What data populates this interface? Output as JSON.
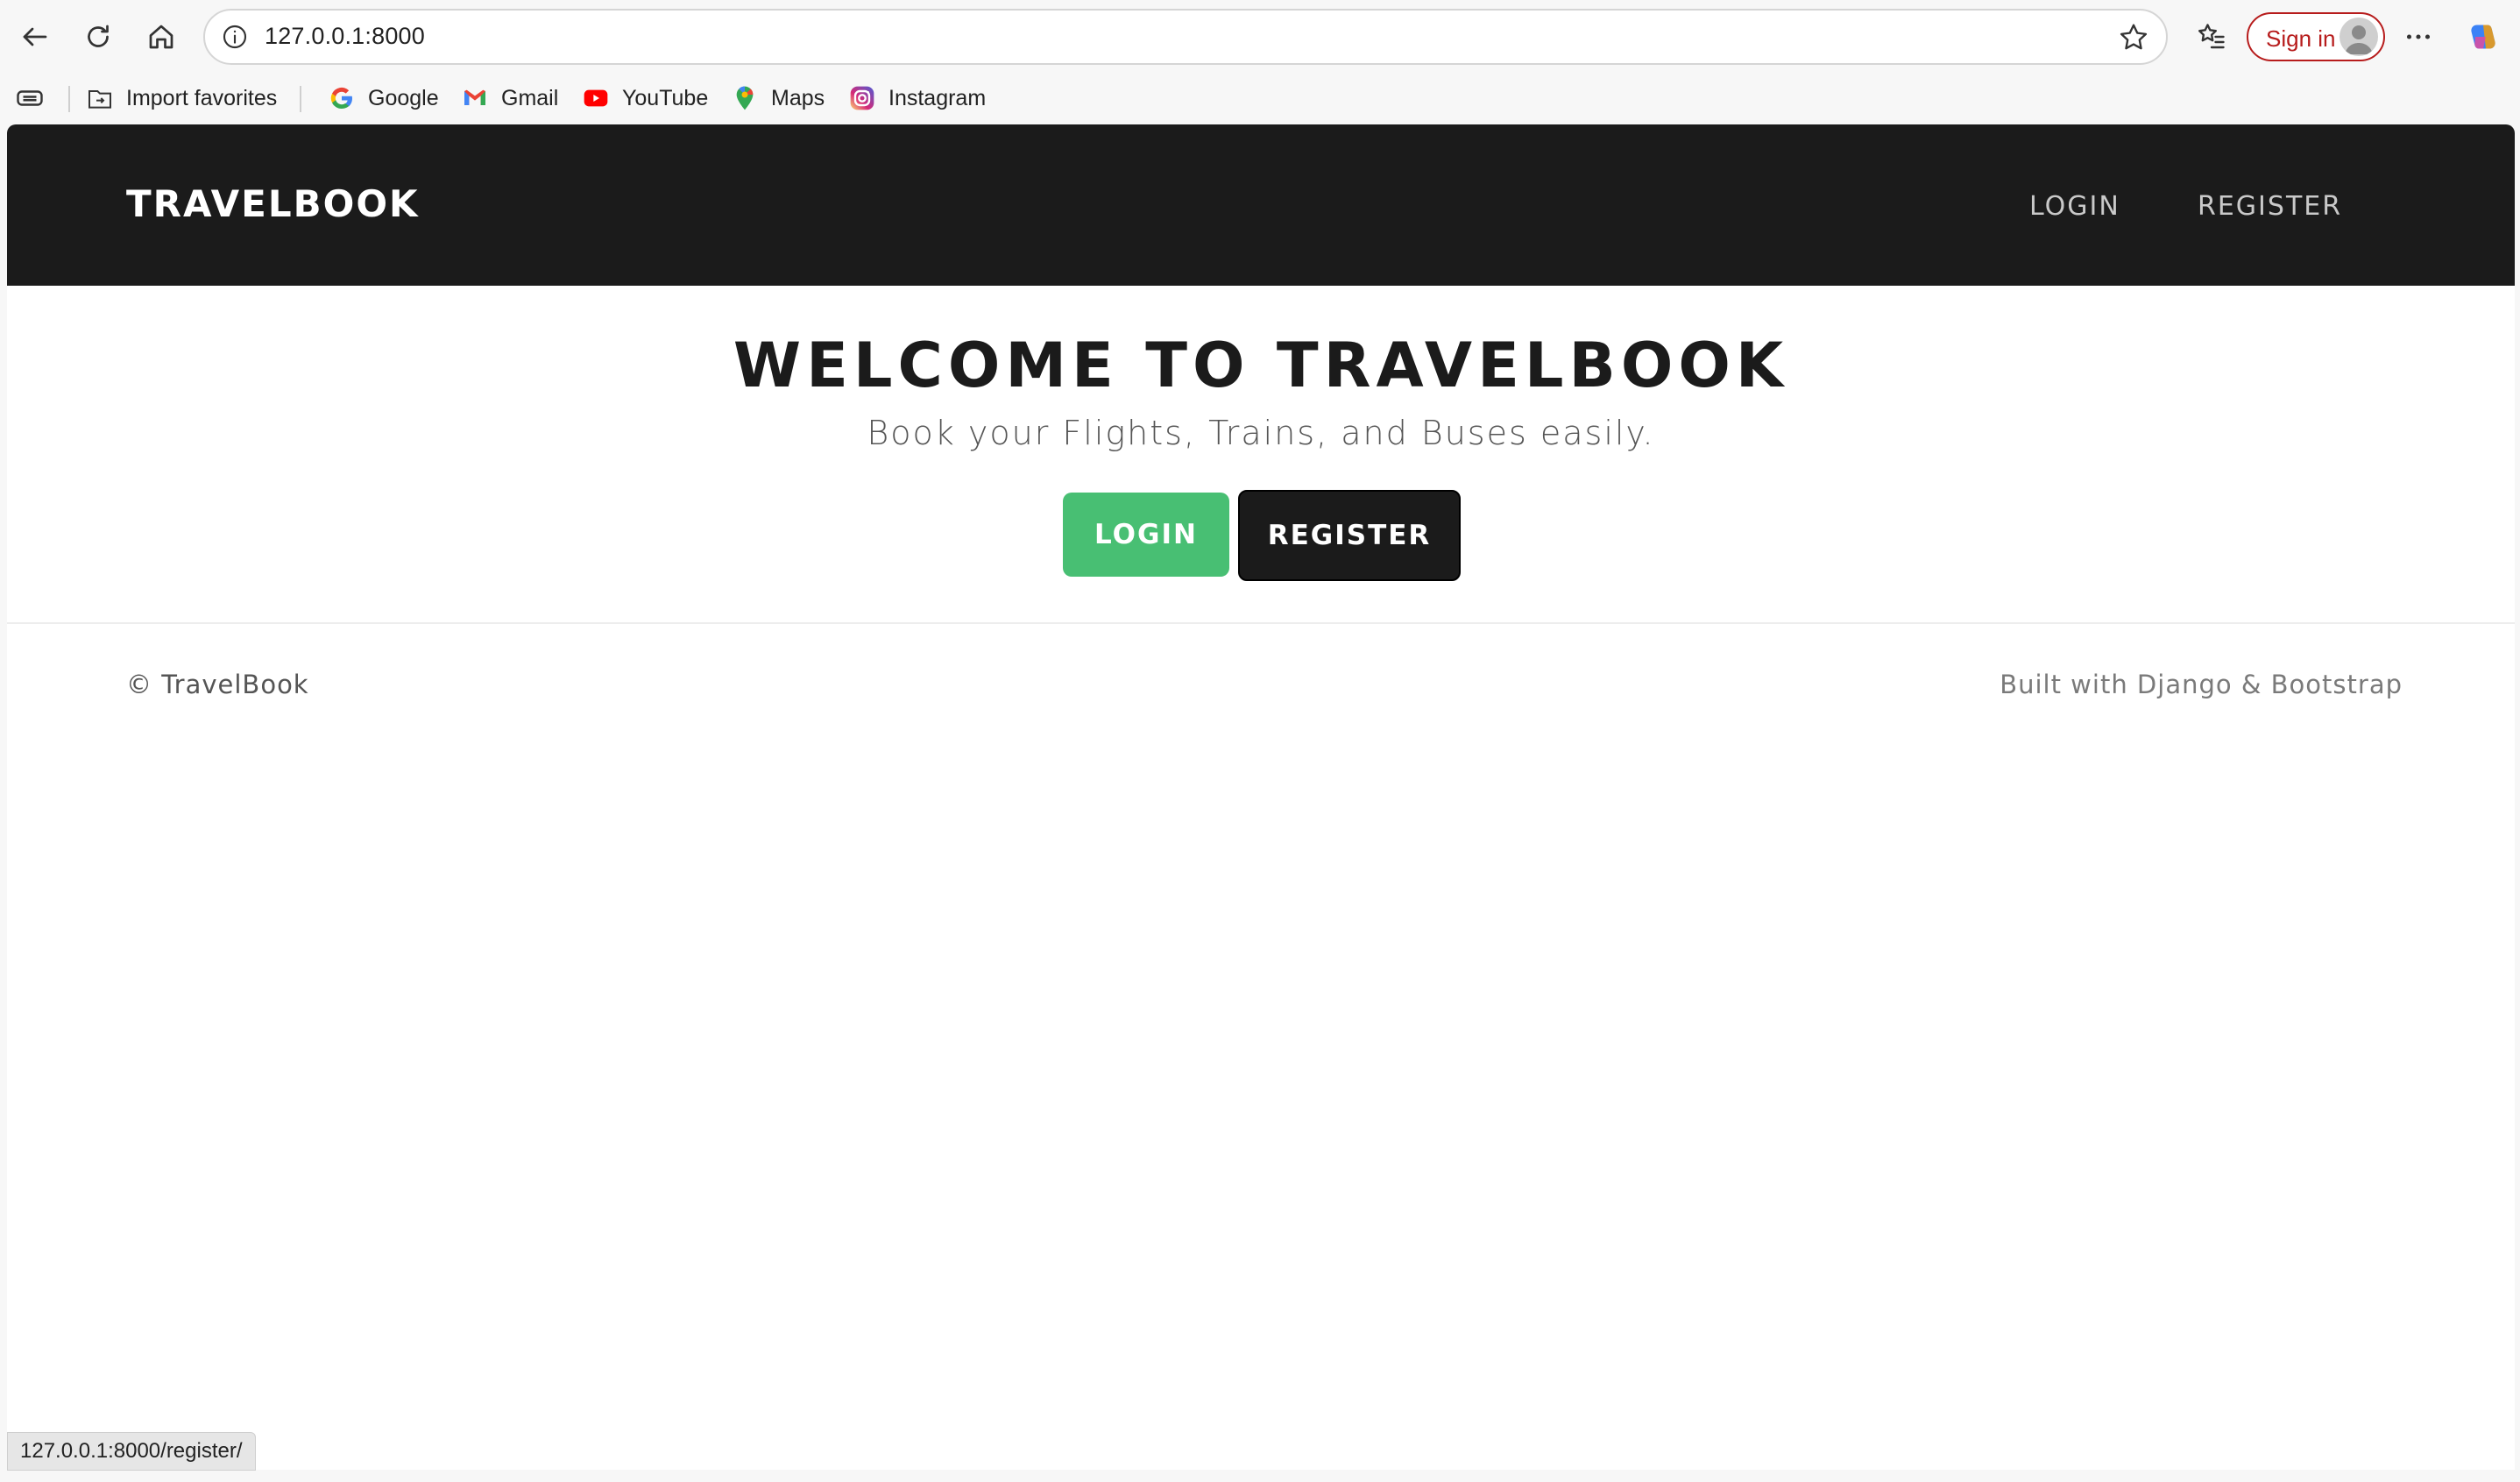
{
  "browser": {
    "url": "127.0.0.1:8000",
    "sign_in_label": "Sign in",
    "status_url": "127.0.0.1:8000/register/",
    "bookmarks": [
      {
        "label": "Import favorites",
        "icon": "import-favorites-icon"
      },
      {
        "label": "Google",
        "icon": "google-icon"
      },
      {
        "label": "Gmail",
        "icon": "gmail-icon"
      },
      {
        "label": "YouTube",
        "icon": "youtube-icon"
      },
      {
        "label": "Maps",
        "icon": "maps-icon"
      },
      {
        "label": "Instagram",
        "icon": "instagram-icon"
      }
    ]
  },
  "site": {
    "brand": "TRAVELBOOK",
    "nav": {
      "login": "LOGIN",
      "register": "REGISTER"
    },
    "hero": {
      "title": "WELCOME TO TRAVELBOOK",
      "subtitle": "Book your Flights, Trains, and Buses easily.",
      "login_button": "LOGIN",
      "register_button": "REGISTER"
    },
    "footer": {
      "left": "© TravelBook",
      "right": "Built with Django & Bootstrap"
    }
  },
  "colors": {
    "navbar_bg": "#1b1b1b",
    "login_button": "#48bf73",
    "register_button": "#1b1b1b",
    "sign_in_accent": "#b71c1c"
  }
}
